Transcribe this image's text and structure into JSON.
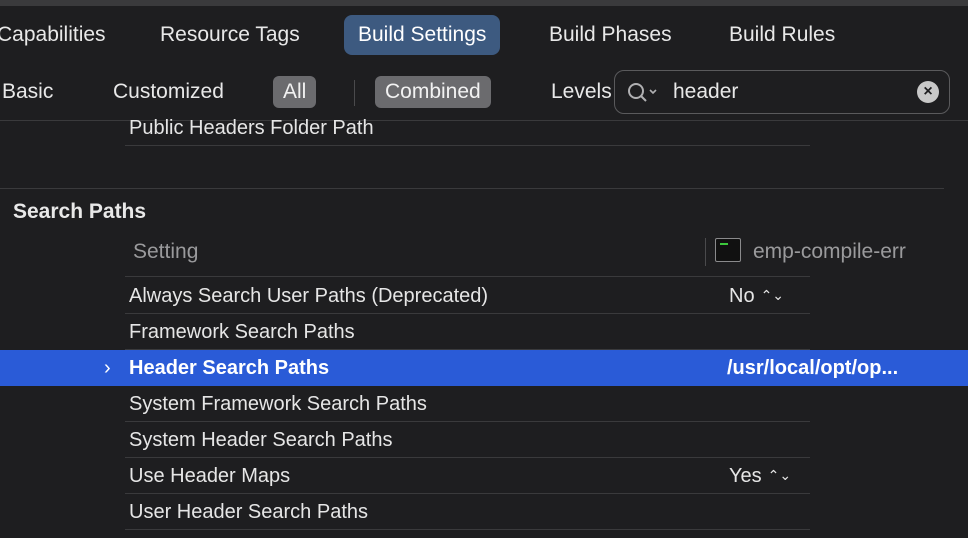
{
  "tabs": {
    "capabilities": "Capabilities",
    "resource_tags": "Resource Tags",
    "build_settings": "Build Settings",
    "build_phases": "Build Phases",
    "build_rules": "Build Rules",
    "active": "Build Settings"
  },
  "filters": {
    "basic": "Basic",
    "customized": "Customized",
    "all": "All",
    "combined": "Combined",
    "levels": "Levels",
    "selected": [
      "All",
      "Combined"
    ]
  },
  "search": {
    "value": "header",
    "icon": "magnifying-glass-icon",
    "clear_icon": "clear-icon"
  },
  "above_rows": {
    "public_headers": "Public Headers Folder Path"
  },
  "section": {
    "title": "Search Paths",
    "header_setting": "Setting",
    "target_name": "emp-compile-err",
    "target_icon": "terminal-target-icon"
  },
  "settings": [
    {
      "label": "Always Search User Paths (Deprecated)",
      "value": "No"
    },
    {
      "label": "Framework Search Paths",
      "value": ""
    },
    {
      "label": "Header Search Paths",
      "value": "/usr/local/opt/op..."
    },
    {
      "label": "System Framework Search Paths",
      "value": ""
    },
    {
      "label": "System Header Search Paths",
      "value": ""
    },
    {
      "label": "Use Header Maps",
      "value": "Yes"
    },
    {
      "label": "User Header Search Paths",
      "value": ""
    }
  ],
  "colors": {
    "background": "#1e1e20",
    "selection": "#2a5bd7",
    "active_tab": "#3d5a80",
    "segment_selected": "#6b6b6e"
  }
}
